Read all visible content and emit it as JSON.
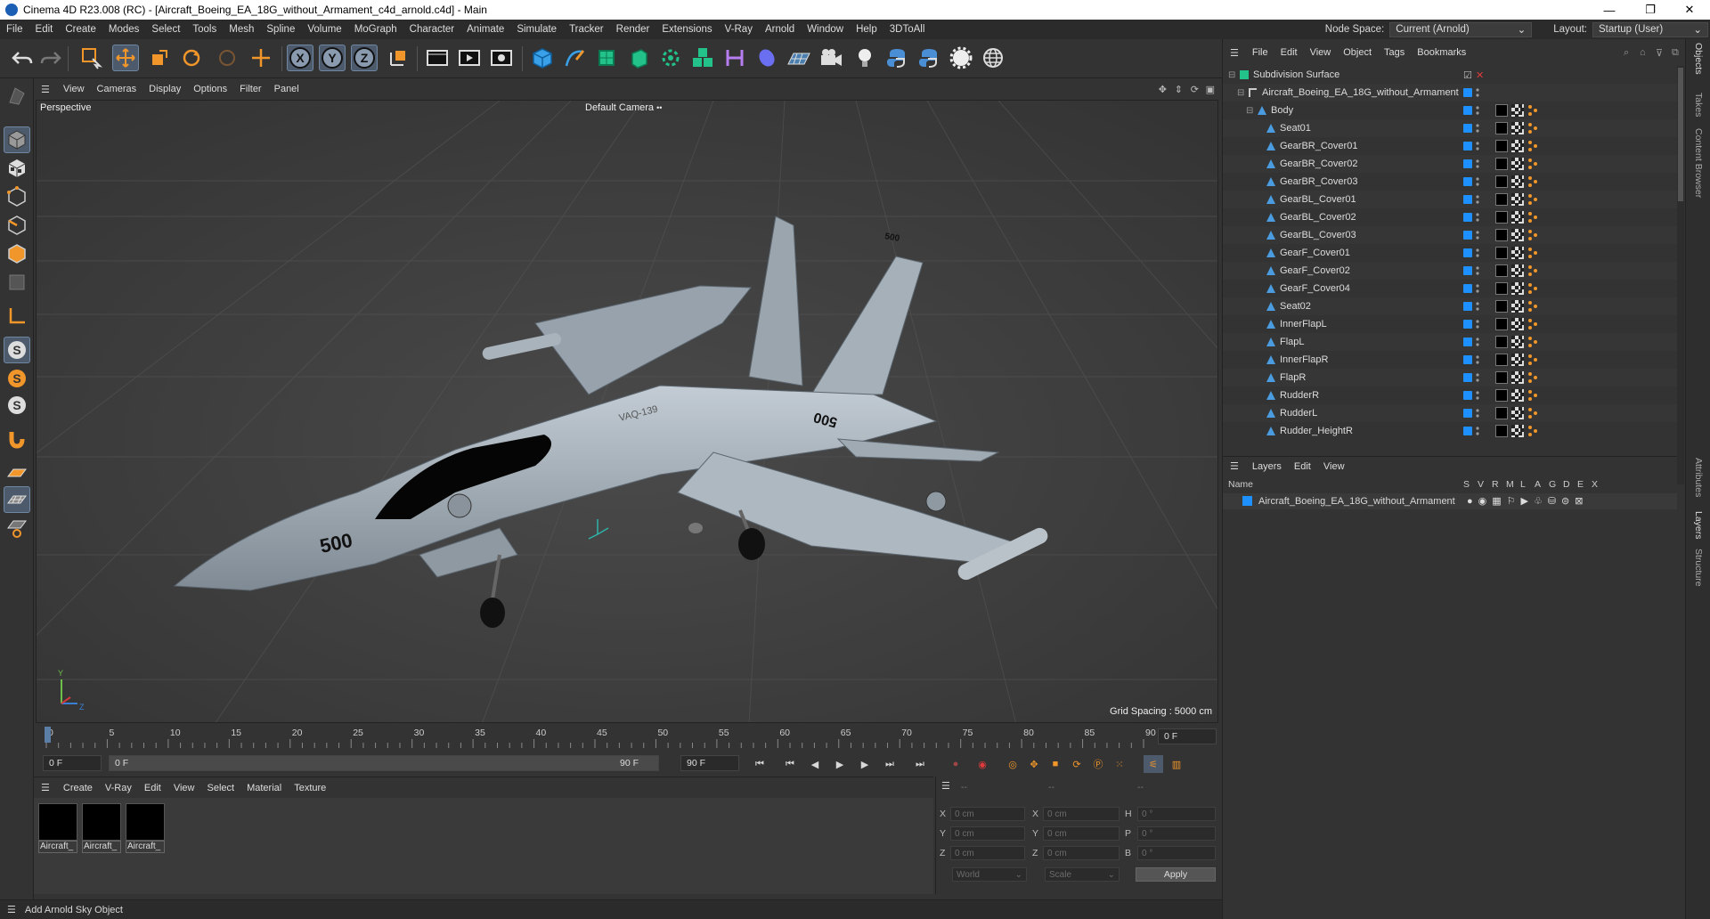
{
  "window": {
    "title": "Cinema 4D R23.008 (RC) - [Aircraft_Boeing_EA_18G_without_Armament_c4d_arnold.c4d] - Main",
    "controls": [
      "—",
      "❐",
      "✕"
    ]
  },
  "menubar": {
    "items": [
      "File",
      "Edit",
      "Create",
      "Modes",
      "Select",
      "Tools",
      "Mesh",
      "Spline",
      "Volume",
      "MoGraph",
      "Character",
      "Animate",
      "Simulate",
      "Tracker",
      "Render",
      "Extensions",
      "V-Ray",
      "Arnold",
      "Window",
      "Help",
      "3DToAll"
    ],
    "node_space_label": "Node Space:",
    "node_space_value": "Current (Arnold)",
    "layout_label": "Layout:",
    "layout_value": "Startup (User)"
  },
  "viewport": {
    "menu": [
      "View",
      "Cameras",
      "Display",
      "Options",
      "Filter",
      "Panel"
    ],
    "view_name": "Perspective",
    "camera": "Default Camera",
    "camera_icon": "••",
    "grid_spacing": "Grid Spacing : 5000 cm",
    "axis_labels": {
      "y": "Y",
      "z": "Z"
    },
    "model_markings": {
      "nose_number": "500",
      "tail_number": "500",
      "wing_number": "500",
      "fuselage_text": "VAQ-139"
    }
  },
  "timeline": {
    "ticks": [
      "0",
      "5",
      "10",
      "15",
      "20",
      "25",
      "30",
      "35",
      "40",
      "45",
      "50",
      "55",
      "60",
      "65",
      "70",
      "75",
      "80",
      "85",
      "90"
    ],
    "current_frame_right": "0 F",
    "start_field": "0 F",
    "range_start": "0 F",
    "range_end": "90 F",
    "end_field": "90 F"
  },
  "material_manager": {
    "menu": [
      "Create",
      "V-Ray",
      "Edit",
      "View",
      "Select",
      "Material",
      "Texture"
    ],
    "materials": [
      "Aircraft_",
      "Aircraft_",
      "Aircraft_"
    ]
  },
  "coordinates": {
    "header": [
      "--",
      "--",
      "--"
    ],
    "labels": {
      "x": "X",
      "y": "Y",
      "z": "Z",
      "x2": "X",
      "y2": "Y",
      "z2": "Z",
      "h": "H",
      "p": "P",
      "b": "B"
    },
    "pos": [
      "0 cm",
      "0 cm",
      "0 cm"
    ],
    "size": [
      "0 cm",
      "0 cm",
      "0 cm"
    ],
    "rot": [
      "0 °",
      "0 °",
      "0 °"
    ],
    "mode_world": "World",
    "mode_scale": "Scale",
    "apply": "Apply"
  },
  "status": {
    "text": "Add Arnold Sky Object"
  },
  "object_manager": {
    "menu": [
      "File",
      "Edit",
      "View",
      "Object",
      "Tags",
      "Bookmarks"
    ],
    "objects": [
      {
        "name": "Subdivision Surface",
        "level": 0
      },
      {
        "name": "Aircraft_Boeing_EA_18G_without_Armament",
        "level": 1
      },
      {
        "name": "Body",
        "level": 2
      },
      {
        "name": "Seat01",
        "level": 3
      },
      {
        "name": "GearBR_Cover01",
        "level": 3
      },
      {
        "name": "GearBR_Cover02",
        "level": 3
      },
      {
        "name": "GearBR_Cover03",
        "level": 3
      },
      {
        "name": "GearBL_Cover01",
        "level": 3
      },
      {
        "name": "GearBL_Cover02",
        "level": 3
      },
      {
        "name": "GearBL_Cover03",
        "level": 3
      },
      {
        "name": "GearF_Cover01",
        "level": 3
      },
      {
        "name": "GearF_Cover02",
        "level": 3
      },
      {
        "name": "GearF_Cover04",
        "level": 3
      },
      {
        "name": "Seat02",
        "level": 3
      },
      {
        "name": "InnerFlapL",
        "level": 3
      },
      {
        "name": "FlapL",
        "level": 3
      },
      {
        "name": "InnerFlapR",
        "level": 3
      },
      {
        "name": "FlapR",
        "level": 3
      },
      {
        "name": "RudderR",
        "level": 3
      },
      {
        "name": "RudderL",
        "level": 3
      },
      {
        "name": "Rudder_HeightR",
        "level": 3
      }
    ]
  },
  "layers_manager": {
    "menu": [
      "Layers",
      "Edit",
      "View"
    ],
    "name_header": "Name",
    "flag_headers": [
      "S",
      "V",
      "R",
      "M",
      "L",
      "A",
      "G",
      "D",
      "E",
      "X"
    ],
    "layer_name": "Aircraft_Boeing_EA_18G_without_Armament"
  },
  "side_tabs": [
    "Objects",
    "Takes",
    "Content Browser",
    "Attributes",
    "Layers",
    "Structure"
  ],
  "colors": {
    "accent_blue": "#1e90ff",
    "selected_tool": "#4c5a6b",
    "orange_icon": "#f0962a"
  }
}
